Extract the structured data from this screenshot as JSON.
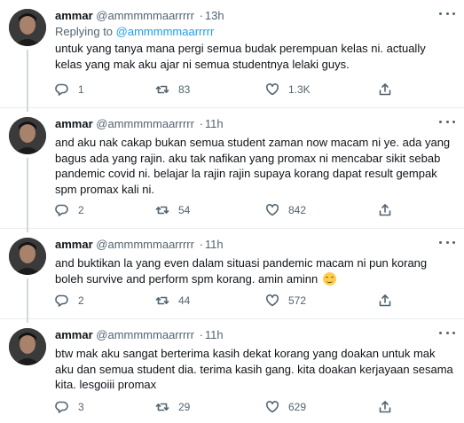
{
  "tweets": [
    {
      "name": "ammar",
      "handle": "@ammmmmaarrrrr",
      "dot": "·",
      "time": "13h",
      "reply_prefix": "Replying to ",
      "reply_mention": "@ammmmmaarrrrr",
      "text": "untuk yang tanya mana pergi semua budak perempuan kelas ni. actually kelas yang mak aku ajar ni semua studentnya lelaki guys.",
      "replies": "1",
      "retweets": "83",
      "likes": "1.3K"
    },
    {
      "name": "ammar",
      "handle": "@ammmmmaarrrrr",
      "dot": "·",
      "time": "11h",
      "text": "and aku nak cakap bukan semua student zaman now macam ni ye. ada yang bagus ada yang rajin. aku tak nafikan yang promax ni mencabar sikit sebab pandemic covid ni. belajar la rajin rajin supaya korang dapat result gempak spm promax kali ni.",
      "replies": "2",
      "retweets": "54",
      "likes": "842"
    },
    {
      "name": "ammar",
      "handle": "@ammmmmaarrrrr",
      "dot": "·",
      "time": "11h",
      "text": "and buktikan la yang even dalam situasi pandemic macam ni pun korang boleh survive and perform spm korang. amin aminn",
      "emoji": "smiling-face",
      "replies": "2",
      "retweets": "44",
      "likes": "572"
    },
    {
      "name": "ammar",
      "handle": "@ammmmmaarrrrr",
      "dot": "·",
      "time": "11h",
      "text": "btw mak aku sangat berterima kasih dekat korang yang doakan untuk mak aku dan semua student dia. terima kasih gang. kita doakan kerjayaan sesama kita. lesgoiii promax",
      "replies": "3",
      "retweets": "29",
      "likes": "629"
    }
  ],
  "icons": {
    "reply": "reply-icon",
    "retweet": "retweet-icon",
    "like": "like-icon",
    "share": "share-icon",
    "more": "more-icon"
  },
  "colors": {
    "link": "#1d9bf0",
    "secondary_text": "#536471",
    "divider": "#e6ecf0"
  }
}
